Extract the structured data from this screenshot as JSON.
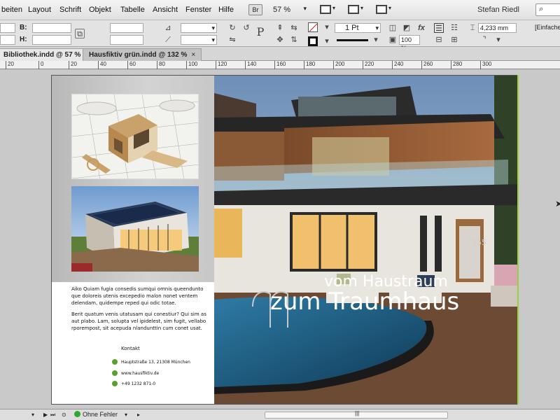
{
  "menu": {
    "items": [
      "beiten",
      "Layout",
      "Schrift",
      "Objekt",
      "Tabelle",
      "Ansicht",
      "Fenster",
      "Hilfe"
    ],
    "bridge_label": "Br",
    "zoom": "57 %",
    "user": "Stefan Riedl",
    "search_icon": "search-icon"
  },
  "control": {
    "b_label": "B:",
    "h_label": "H:",
    "stroke_weight": "1 Pt",
    "opacity": "100 %",
    "measure": "4,233 mm",
    "style": "[Einfacher"
  },
  "tabs": [
    {
      "label": "Bibliothek.indd @ 57 %",
      "close": "×"
    },
    {
      "label": "Hausfiktiv grün.indd @ 132 %",
      "close": "×"
    }
  ],
  "ruler": [
    "20",
    "0",
    "20",
    "40",
    "60",
    "80",
    "100",
    "120",
    "140",
    "160",
    "180",
    "200",
    "220",
    "240",
    "260",
    "280",
    "300"
  ],
  "page": {
    "body": [
      "Aiko Quiam fugia consedis sumqui omnis queendunto que doloreis utenis excepedio malon nonet ventem delendam, quidempe reped qui odic totae.",
      "Berit quatum venis utatusam qui conestiur? Qui sim as aut plabo. Lam, solupta vel ipidelest, sim fugit, vellabo rporempost, sit acepuda nlandunttin cum conet usat."
    ],
    "kontakt_label": "Kontakt",
    "contact": [
      {
        "icon": "location-icon",
        "text": "Hauptstraße 13, 21308 München"
      },
      {
        "icon": "web-icon",
        "text": "www.hausfiktiv.de"
      },
      {
        "icon": "phone-icon",
        "text": "+49 1232 871-0"
      }
    ],
    "headline_1": "vom Haustraum",
    "headline_2": "zum Traumhaus",
    "house_number": "555"
  },
  "status": {
    "errors": "Ohne Fehler"
  },
  "colors": {
    "accent_green": "#5aa02c",
    "status_green": "#2ea82e"
  }
}
